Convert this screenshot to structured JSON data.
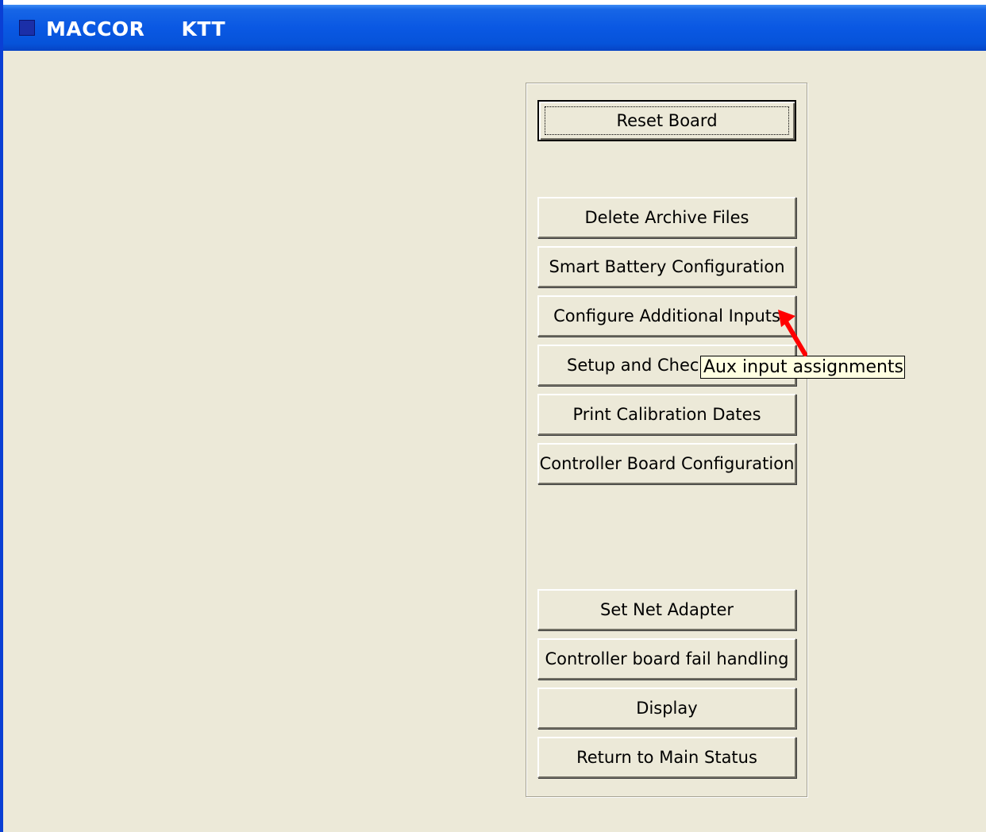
{
  "window": {
    "title": "MACCOR     KTT"
  },
  "buttons": {
    "reset_board": "Reset Board",
    "delete_archive_files": "Delete Archive Files",
    "smart_battery_configuration": "Smart Battery Configuration",
    "configure_additional_inputs": "Configure Additional Inputs",
    "setup_and_check": "Setup and Check",
    "print_calibration_dates": "Print Calibration Dates",
    "controller_board_configuration": "Controller Board Configuration",
    "set_net_adapter": "Set Net Adapter",
    "controller_board_fail_handling": "Controller board fail handling",
    "display": "Display",
    "return_to_main_status": "Return to Main Status"
  },
  "tooltip": {
    "text": "Aux input assignments"
  },
  "colors": {
    "titlebar": "#0a58e3",
    "face": "#ece9d8",
    "tooltip_bg": "#ffffe1",
    "annotation_arrow": "#ff0000"
  },
  "icons": {
    "app": "app-icon",
    "annotation": "red-arrow-icon"
  }
}
